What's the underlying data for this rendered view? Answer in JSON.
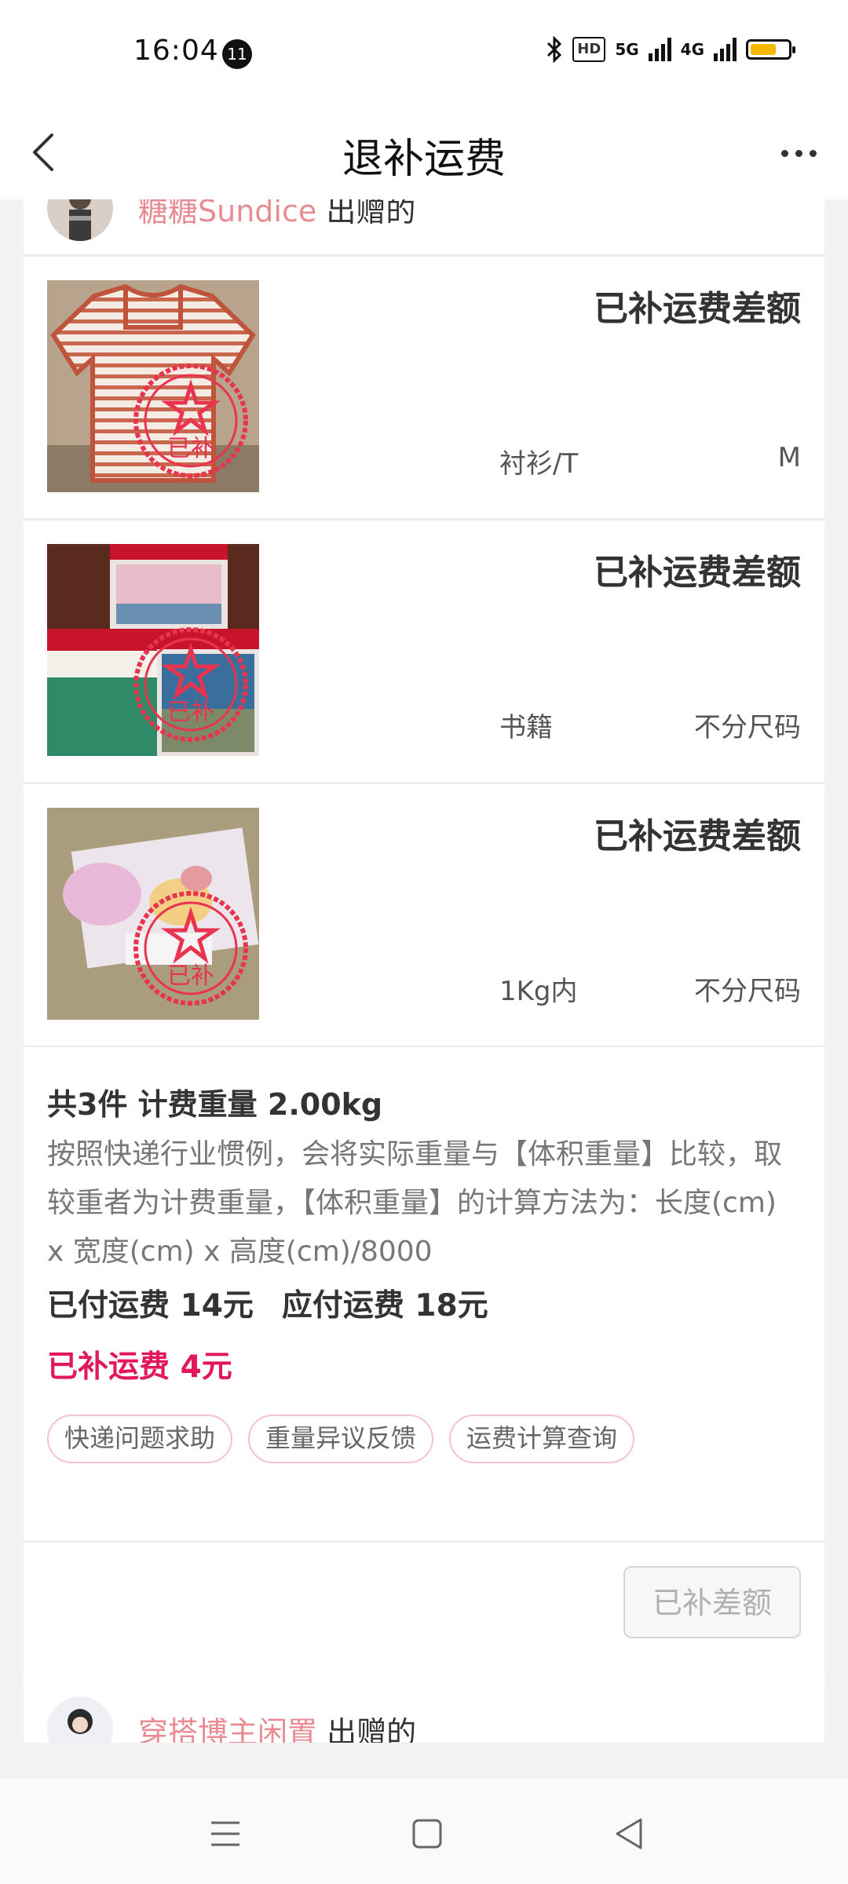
{
  "status_bar": {
    "time": "16:04",
    "notification_count": "11",
    "network_hd": "HD",
    "network_5g": "5G",
    "network_4g": "4G",
    "battery_level": 0.7,
    "battery_color": "#f5b800"
  },
  "nav": {
    "title": "退补运费",
    "back_icon": "chevron-left-icon",
    "more_icon": "more-horizontal-icon"
  },
  "order1": {
    "seller_name": "糖糖Sundice",
    "seller_suffix": "出赠的",
    "items": [
      {
        "status": "已补运费差额",
        "category": "衬衫/T",
        "size": "M",
        "stamp": "已补"
      },
      {
        "status": "已补运费差额",
        "category": "书籍",
        "size": "不分尺码",
        "stamp": "已补"
      },
      {
        "status": "已补运费差额",
        "category": "1Kg内",
        "size": "不分尺码",
        "stamp": "已补"
      }
    ],
    "summary": {
      "title": "共3件 计费重量 2.00kg",
      "description": "按照快递行业惯例，会将实际重量与【体积重量】比较，取较重者为计费重量，【体积重量】的计算方法为：长度(cm) x 宽度(cm) x 高度(cm)/8000",
      "paid": "已付运费 14元",
      "due": "应付运费 18元",
      "supplemented": "已补运费 4元"
    },
    "chips": [
      "快递问题求助",
      "重量异议反馈",
      "运费计算查询"
    ],
    "action_button": "已补差额"
  },
  "order2": {
    "seller_name": "穿搭博主闲置",
    "seller_suffix": "出赠的"
  },
  "system_nav": {
    "menu_icon": "menu-icon",
    "home_icon": "home-square-icon",
    "back_icon": "back-triangle-icon"
  },
  "colors": {
    "accent_pink": "#e88b93",
    "highlight_red": "#e2185b",
    "stamp_red": "#e8344f"
  }
}
